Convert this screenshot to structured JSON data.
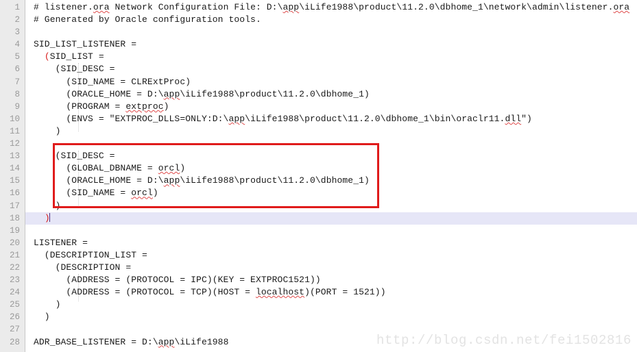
{
  "editor": {
    "title": "listener.ora",
    "gutter_bg": "#ebebeb",
    "highlight_color": "#e6e6f7",
    "bracket_match_color": "#d81a1a",
    "annotation_box_color": "#e01b1b",
    "caret_color": "#4b2a80",
    "current_line": 18,
    "total_lines_visible": 28
  },
  "annotation": {
    "name": "red-highlight-rectangle",
    "covers_lines": [
      13,
      14,
      15,
      16,
      17
    ],
    "color": "#e01b1b"
  },
  "watermark": {
    "text": "http://blog.csdn.net/fei1502816",
    "color": "#e3e3e3"
  },
  "lines": [
    {
      "n": "1",
      "text": "# listener.ora Network Configuration File: D:\\app\\iLife1988\\product\\11.2.0\\dbhome_1\\network\\admin\\listener.ora"
    },
    {
      "n": "2",
      "text": "# Generated by Oracle configuration tools."
    },
    {
      "n": "3",
      "text": ""
    },
    {
      "n": "4",
      "text": "SID_LIST_LISTENER ="
    },
    {
      "n": "5",
      "text": "  (SID_LIST ="
    },
    {
      "n": "6",
      "text": "    (SID_DESC ="
    },
    {
      "n": "7",
      "text": "      (SID_NAME = CLRExtProc)"
    },
    {
      "n": "8",
      "text": "      (ORACLE_HOME = D:\\app\\iLife1988\\product\\11.2.0\\dbhome_1)"
    },
    {
      "n": "9",
      "text": "      (PROGRAM = extproc)"
    },
    {
      "n": "10",
      "text": "      (ENVS = \"EXTPROC_DLLS=ONLY:D:\\app\\iLife1988\\product\\11.2.0\\dbhome_1\\bin\\oraclr11.dll\")"
    },
    {
      "n": "11",
      "text": "    )"
    },
    {
      "n": "12",
      "text": ""
    },
    {
      "n": "13",
      "text": "    (SID_DESC ="
    },
    {
      "n": "14",
      "text": "      (GLOBAL_DBNAME = orcl)"
    },
    {
      "n": "15",
      "text": "      (ORACLE_HOME = D:\\app\\iLife1988\\product\\11.2.0\\dbhome_1)"
    },
    {
      "n": "16",
      "text": "      (SID_NAME = orcl)"
    },
    {
      "n": "17",
      "text": "    )"
    },
    {
      "n": "18",
      "text": "  )"
    },
    {
      "n": "19",
      "text": ""
    },
    {
      "n": "20",
      "text": "LISTENER ="
    },
    {
      "n": "21",
      "text": "  (DESCRIPTION_LIST ="
    },
    {
      "n": "22",
      "text": "    (DESCRIPTION ="
    },
    {
      "n": "23",
      "text": "      (ADDRESS = (PROTOCOL = IPC)(KEY = EXTPROC1521))"
    },
    {
      "n": "24",
      "text": "      (ADDRESS = (PROTOCOL = TCP)(HOST = localhost)(PORT = 1521))"
    },
    {
      "n": "25",
      "text": "    )"
    },
    {
      "n": "26",
      "text": "  )"
    },
    {
      "n": "27",
      "text": ""
    },
    {
      "n": "28",
      "text": "ADR_BASE_LISTENER = D:\\app\\iLife1988"
    }
  ],
  "spellcheck_words": [
    "ora",
    "app",
    "extproc",
    "dll",
    "orcl",
    "localhost"
  ]
}
